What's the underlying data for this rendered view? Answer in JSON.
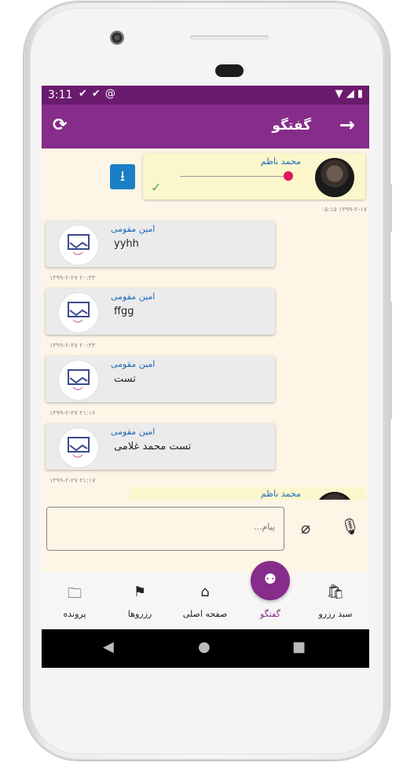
{
  "status_bar": {
    "time": "3:11",
    "left_icons": [
      "check-icon",
      "check-icon",
      "at-icon"
    ],
    "right_icons": [
      "wifi-icon",
      "signal-icon",
      "battery-icon"
    ]
  },
  "app_bar": {
    "title": "گفتگو",
    "refresh_icon": "refresh-icon",
    "back_icon": "arrow-right-icon",
    "color": "#862c8a"
  },
  "messages": [
    {
      "direction": "out",
      "type": "voice",
      "sender": "محمد ناظم",
      "timestamp": "۰۵:۱۵ ۱۳۹۹-۲-۱۷",
      "status": "sent"
    },
    {
      "direction": "in",
      "type": "text",
      "sender": "امین مقومی",
      "text": "yyhh",
      "timestamp": "۱۳۹۹-۲-۲۷   ۲۰:۳۳"
    },
    {
      "direction": "in",
      "type": "text",
      "sender": "امین مقومی",
      "text": "ffgg",
      "timestamp": "۱۳۹۹-۲-۲۷   ۲۰:۳۳"
    },
    {
      "direction": "in",
      "type": "text",
      "sender": "امین مقومی",
      "text": "تست",
      "timestamp": "۱۳۹۹-۲-۲۷   ۲۱:۱۶"
    },
    {
      "direction": "in",
      "type": "text",
      "sender": "امین مقومی",
      "text": "تست محمد غلامی",
      "timestamp": "۱۳۹۹-۲-۲۷   ۲۱:۱۷"
    },
    {
      "direction": "out",
      "type": "partial",
      "sender": "محمد ناظم"
    }
  ],
  "compose": {
    "placeholder": "پیام...",
    "attach_icon": "paperclip-icon",
    "mic_icon": "mic-icon"
  },
  "bottom_nav": {
    "items": [
      {
        "label": "پرونده",
        "icon": "folder-icon"
      },
      {
        "label": "رزروها",
        "icon": "golf-flag-icon"
      },
      {
        "label": "صفحه اصلی",
        "icon": "home-icon"
      },
      {
        "label": "گفتگو",
        "icon": "group-chat-icon",
        "active": true
      },
      {
        "label": "سبد رزرو",
        "icon": "shopping-bag-icon"
      }
    ]
  },
  "colors": {
    "status_bar": "#6a1b6e",
    "primary": "#862c8a",
    "chat_bg": "#fdf5e6",
    "outgoing_bubble": "#fbf6cc",
    "incoming_bubble": "#ebebeb",
    "sender_name": "#1e6bb8",
    "voice_knob": "#e0175a",
    "download_button": "#1a7fc6"
  }
}
